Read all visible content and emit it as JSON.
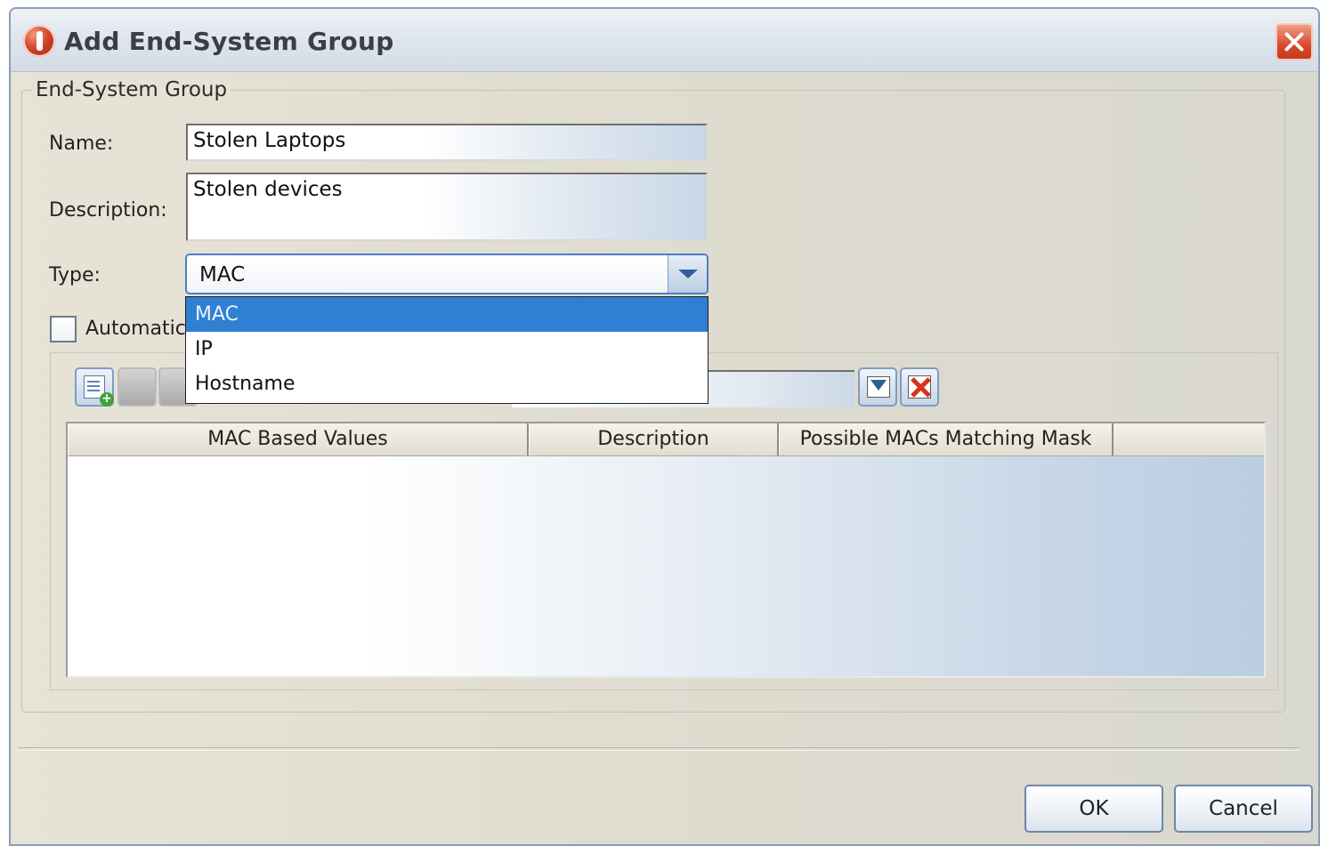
{
  "window": {
    "title": "Add End-System Group"
  },
  "group": {
    "legend": "End-System Group",
    "name_label": "Name:",
    "name_value": "Stolen Laptops",
    "description_label": "Description:",
    "description_value": "Stolen devices",
    "type_label": "Type:",
    "type_value": "MAC",
    "type_options": [
      "MAC",
      "IP",
      "Hostname"
    ],
    "automatic_label": "Automatic"
  },
  "table": {
    "columns": [
      "MAC Based Values",
      "Description",
      "Possible MACs Matching Mask"
    ],
    "rows": []
  },
  "buttons": {
    "ok": "OK",
    "cancel": "Cancel"
  },
  "colors": {
    "selection": "#2f7fd3",
    "close_button": "#d84a2b"
  }
}
